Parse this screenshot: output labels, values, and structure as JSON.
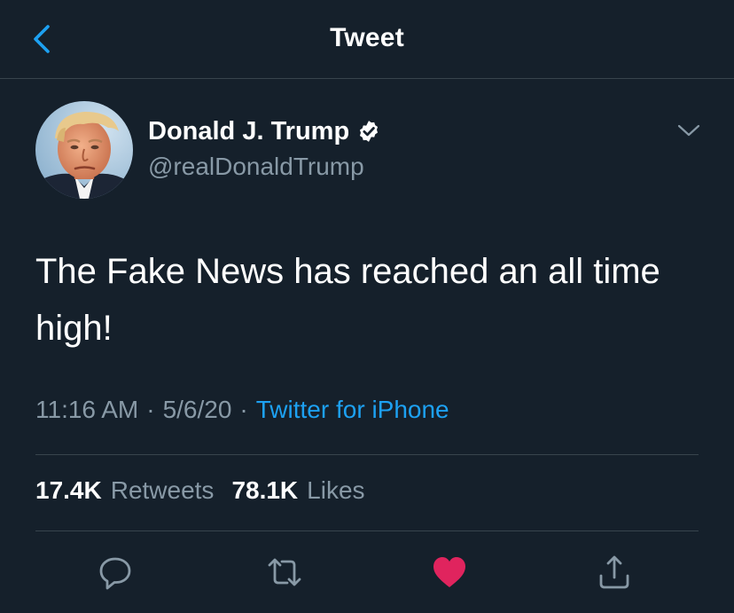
{
  "header": {
    "title": "Tweet",
    "back_icon": "chevron-left-icon"
  },
  "author": {
    "display_name": "Donald J. Trump",
    "handle": "@realDonaldTrump",
    "verified": true
  },
  "tweet": {
    "text": "The Fake News has reached an all time high!",
    "time": "11:16 AM",
    "date": "5/6/20",
    "separator": "·",
    "source": "Twitter for iPhone"
  },
  "stats": {
    "retweets_count": "17.4K",
    "retweets_label": "Retweets",
    "likes_count": "78.1K",
    "likes_label": "Likes"
  },
  "actions": {
    "reply_icon": "reply-icon",
    "retweet_icon": "retweet-icon",
    "like_icon": "heart-icon",
    "share_icon": "share-icon",
    "liked": true
  },
  "colors": {
    "background": "#15202b",
    "divider": "#38444d",
    "accent": "#1da1f2",
    "secondary_text": "#8899a6",
    "like": "#e0245e"
  }
}
